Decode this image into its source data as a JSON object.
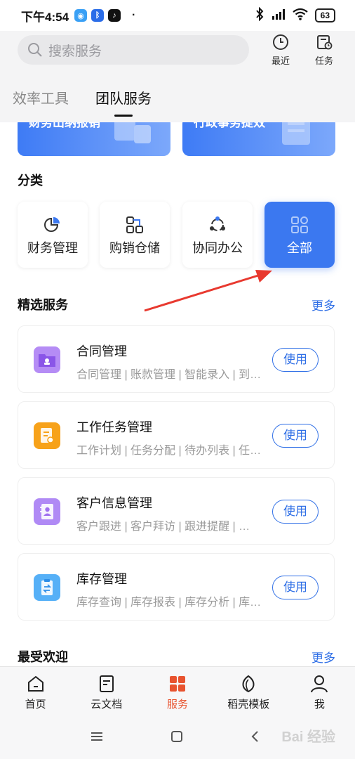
{
  "status_bar": {
    "time": "下午4:54",
    "battery": "63",
    "dot": "·"
  },
  "search": {
    "placeholder": "搜索服务"
  },
  "header_buttons": {
    "recent": "最近",
    "tasks": "任务"
  },
  "tabs": [
    {
      "label": "效率工具",
      "active": false
    },
    {
      "label": "团队服务",
      "active": true
    }
  ],
  "banners": [
    {
      "label": "财务出纳报销"
    },
    {
      "label": "行政事务提效"
    }
  ],
  "categories": {
    "title": "分类",
    "items": [
      {
        "label": "财务管理",
        "icon": "pie-chart-icon"
      },
      {
        "label": "购销仓储",
        "icon": "flow-icon"
      },
      {
        "label": "协同办公",
        "icon": "collaboration-icon"
      },
      {
        "label": "全部",
        "icon": "grid-icon",
        "active": true
      }
    ]
  },
  "featured": {
    "title": "精选服务",
    "more": "更多",
    "items": [
      {
        "name": "合同管理",
        "desc": "合同管理 | 账款管理 | 智能录入 | 到…",
        "button": "使用",
        "icon": "contract-folder-icon",
        "color": "#9b6cf0"
      },
      {
        "name": "工作任务管理",
        "desc": "工作计划 | 任务分配 | 待办列表 | 任…",
        "button": "使用",
        "icon": "task-checklist-icon",
        "color": "#f7a21a"
      },
      {
        "name": "客户信息管理",
        "desc": "客户跟进 | 客户拜访 | 跟进提醒 | …",
        "button": "使用",
        "icon": "contact-book-icon",
        "color": "#a979f2"
      },
      {
        "name": "库存管理",
        "desc": "库存查询 | 库存报表 | 库存分析 | 库…",
        "button": "使用",
        "icon": "inventory-clipboard-icon",
        "color": "#4aa3f5"
      }
    ]
  },
  "popular": {
    "title": "最受欢迎",
    "more": "更多"
  },
  "bottom_nav": [
    {
      "label": "首页",
      "icon": "home-icon"
    },
    {
      "label": "云文档",
      "icon": "document-icon"
    },
    {
      "label": "服务",
      "icon": "services-grid-icon",
      "active": true
    },
    {
      "label": "稻壳模板",
      "icon": "leaf-icon"
    },
    {
      "label": "我",
      "icon": "person-icon"
    }
  ],
  "watermark": "Bai 经验",
  "colors": {
    "accent": "#2f6fe6",
    "active_nav": "#e8532f",
    "category_active": "#3b78f0",
    "annotation_arrow": "#e8392f"
  }
}
